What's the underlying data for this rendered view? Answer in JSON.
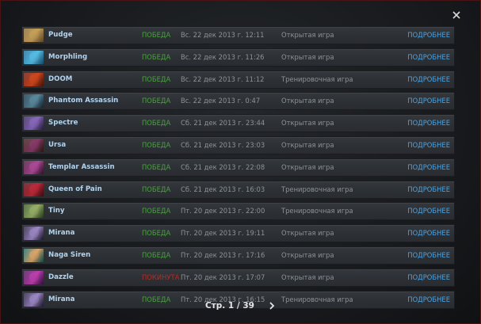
{
  "window": {
    "close_icon": "close-icon"
  },
  "matches": [
    {
      "hero": "Pudge",
      "result": "ПОБЕДА",
      "result_type": "win",
      "date": "Вс. 22 дек 2013 г. 12:11",
      "mode": "Открытая игра",
      "details": "ПОДРОБНЕЕ",
      "portrait_colors": [
        "#8a6a3a",
        "#c9a25a"
      ]
    },
    {
      "hero": "Morphling",
      "result": "ПОБЕДА",
      "result_type": "win",
      "date": "Вс. 22 дек 2013 г. 11:26",
      "mode": "Открытая игра",
      "details": "ПОДРОБНЕЕ",
      "portrait_colors": [
        "#1f6f9a",
        "#58c0e8"
      ]
    },
    {
      "hero": "DOOM",
      "result": "ПОБЕДА",
      "result_type": "win",
      "date": "Вс. 22 дек 2013 г. 11:12",
      "mode": "Тренировочная игра",
      "details": "ПОДРОБНЕЕ",
      "portrait_colors": [
        "#6a1a10",
        "#d2481e"
      ]
    },
    {
      "hero": "Phantom Assassin",
      "result": "ПОБЕДА",
      "result_type": "win",
      "date": "Вс. 22 дек 2013 г. 0:47",
      "mode": "Открытая игра",
      "details": "ПОДРОБНЕЕ",
      "portrait_colors": [
        "#1a3848",
        "#5c8aa0"
      ]
    },
    {
      "hero": "Spectre",
      "result": "ПОБЕДА",
      "result_type": "win",
      "date": "Сб. 21 дек 2013 г. 23:44",
      "mode": "Открытая игра",
      "details": "ПОДРОБНЕЕ",
      "portrait_colors": [
        "#3a2a5a",
        "#8a6ac0"
      ]
    },
    {
      "hero": "Ursa",
      "result": "ПОБЕДА",
      "result_type": "win",
      "date": "Сб. 21 дек 2013 г. 23:03",
      "mode": "Открытая игра",
      "details": "ПОДРОБНЕЕ",
      "portrait_colors": [
        "#3a2418",
        "#8a3a6a"
      ]
    },
    {
      "hero": "Templar Assassin",
      "result": "ПОБЕДА",
      "result_type": "win",
      "date": "Сб. 21 дек 2013 г. 22:08",
      "mode": "Открытая игра",
      "details": "ПОДРОБНЕЕ",
      "portrait_colors": [
        "#4a1a3a",
        "#b04a9a"
      ]
    },
    {
      "hero": "Queen of Pain",
      "result": "ПОБЕДА",
      "result_type": "win",
      "date": "Сб. 21 дек 2013 г. 16:03",
      "mode": "Тренировочная игра",
      "details": "ПОДРОБНЕЕ",
      "portrait_colors": [
        "#5a1018",
        "#c02a3a"
      ]
    },
    {
      "hero": "Tiny",
      "result": "ПОБЕДА",
      "result_type": "win",
      "date": "Пт. 20 дек 2013 г. 22:00",
      "mode": "Тренировочная игра",
      "details": "ПОДРОБНЕЕ",
      "portrait_colors": [
        "#3a5a2a",
        "#9ab06a"
      ]
    },
    {
      "hero": "Mirana",
      "result": "ПОБЕДА",
      "result_type": "win",
      "date": "Пт. 20 дек 2013 г. 19:11",
      "mode": "Открытая игра",
      "details": "ПОДРОБНЕЕ",
      "portrait_colors": [
        "#2a2440",
        "#a08ac8"
      ]
    },
    {
      "hero": "Naga Siren",
      "result": "ПОБЕДА",
      "result_type": "win",
      "date": "Пт. 20 дек 2013 г. 17:16",
      "mode": "Открытая игра",
      "details": "ПОДРОБНЕЕ",
      "portrait_colors": [
        "#1a6a6a",
        "#e0a86a"
      ]
    },
    {
      "hero": "Dazzle",
      "result": "ПОКИНУТА",
      "result_type": "abandon",
      "date": "Пт. 20 дек 2013 г. 17:07",
      "mode": "Открытая игра",
      "details": "ПОДРОБНЕЕ",
      "portrait_colors": [
        "#4a1a5a",
        "#c040b0"
      ]
    },
    {
      "hero": "Mirana",
      "result": "ПОБЕДА",
      "result_type": "win",
      "date": "Пт. 20 дек 2013 г. 16:15",
      "mode": "Тренировочная игра",
      "details": "ПОДРОБНЕЕ",
      "portrait_colors": [
        "#2a2440",
        "#a08ac8"
      ]
    }
  ],
  "pager": {
    "label": "Стр. 1 / 39",
    "next_icon": "chevron-right-icon"
  },
  "colors": {
    "win": "#4ca342",
    "abandon": "#b92c24",
    "hero_name": "#b3d4ef",
    "details_link": "#4ea3df",
    "muted_text": "#8e9296",
    "frame_border": "#4a1414"
  }
}
